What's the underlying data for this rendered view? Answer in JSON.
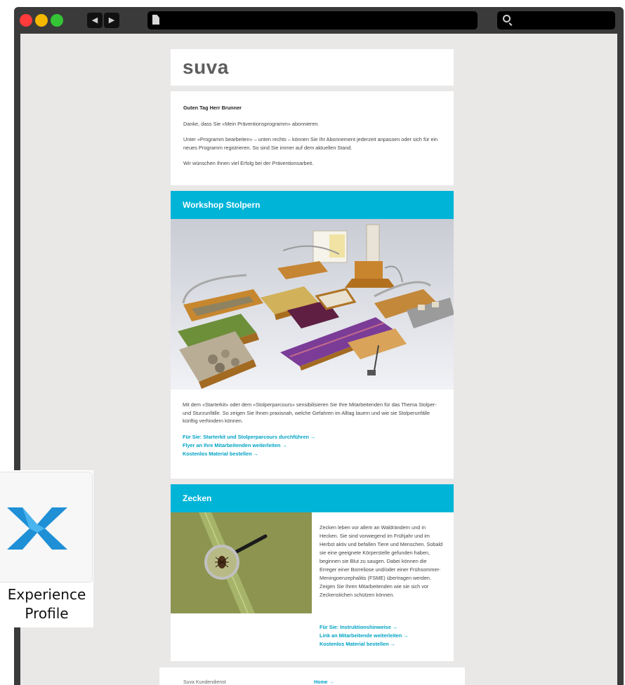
{
  "browser": {
    "back_glyph": "◀",
    "forward_glyph": "▶",
    "traffic_colors": [
      "#ff3b3b",
      "#f5b800",
      "#35c435"
    ]
  },
  "email": {
    "logo": "suva",
    "greeting": "Guten Tag Herr Brunner",
    "paragraphs": [
      "Danke, dass Sie «Mein Präventionsprogramm» abonnieren.",
      "Unter «Programm bearbeiten» – unten rechts – können Sie Ihr Abonnement jederzeit anpassen oder sich für ein neues Programm registrieren. So sind Sie immer auf dem aktuellen Stand.",
      "Wir wünschen Ihnen viel Erfolg bei der Präventionsarbeit."
    ],
    "workshop": {
      "title": "Workshop Stolpern",
      "text": "Mit dem «Starterkit» oder dem «Stolperparcours» sensibilisieren Sie Ihre Mitarbeitenden für das Thema Stolper- und Sturzunfälle. So zeigen Sie Ihnen praxisnah, welche Gefahren im Alltag lauern und wie sie Stolperunfälle künftig verhindern können.",
      "links": [
        "Für Sie: Starterkit und Stolperparcours durchführen →",
        "Flyer an Ihre Mitarbeitenden weiterleiten →",
        "Kostenlos Material bestellen →"
      ]
    },
    "zecken": {
      "title": "Zecken",
      "text": "Zecken leben vor allem an Waldrändern und in Hecken. Sie sind vorwiegend im Frühjahr und im Herbst aktiv und befallen Tiere und Menschen. Sobald sie eine geeignete Körperstelle gefunden haben, beginnen sie Blut zu saugen. Dabei können die Erreger einer Borreliose und/oder einer Frühsommer-Meningoenzephalitis (FSME) übertragen werden. Zeigen Sie Ihren Mitarbeitenden wie sie sich vor Zeckenstichen schützen können.",
      "links": [
        "Für Sie: Instruktionshinweise →",
        "Link an Mitarbeitende weiterleiten →",
        "Kostenlos Material bestellen →"
      ]
    },
    "footer": {
      "left": "Suva Kundendienst",
      "right": "Home →"
    },
    "accent_color": "#00b4d8",
    "link_color": "#00a3c4"
  },
  "desktop": {
    "app_label": "Experience Profile",
    "icon": "experience-profile-x-icon"
  }
}
